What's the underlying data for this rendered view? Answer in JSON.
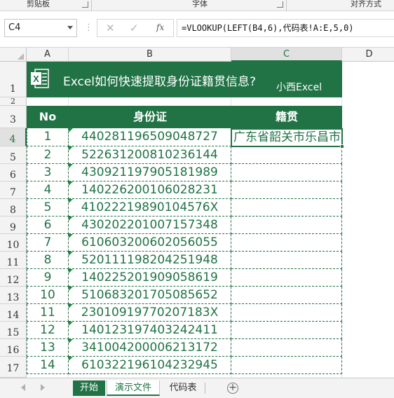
{
  "ribbon": {
    "groups": [
      "剪贴板",
      "字体",
      "对齐方式"
    ]
  },
  "formula_bar": {
    "cell_ref": "C4",
    "cancel_glyph": "✕",
    "enter_glyph": "✓",
    "fx_label": "fx",
    "formula": "=VLOOKUP(LEFT(B4,6),代码表!A:E,5,0)"
  },
  "columns": [
    "A",
    "B",
    "C",
    "D"
  ],
  "rows": [
    "1",
    "2",
    "3",
    "4",
    "5",
    "6",
    "7",
    "8",
    "9",
    "10",
    "11",
    "12",
    "13",
    "14",
    "15",
    "16",
    "17"
  ],
  "banner": {
    "icon_letter": "X",
    "title": "Excel如何快速提取身份证籍贯信息?",
    "brand": "小西Excel"
  },
  "table": {
    "headers": [
      "No",
      "身份证",
      "籍贯"
    ],
    "rows": [
      {
        "no": "1",
        "id": "440281196509048727",
        "origin": "广东省韶关市乐昌市"
      },
      {
        "no": "2",
        "id": "522631200810236144",
        "origin": ""
      },
      {
        "no": "3",
        "id": "430921197905181989",
        "origin": ""
      },
      {
        "no": "4",
        "id": "140226200106028231",
        "origin": ""
      },
      {
        "no": "5",
        "id": "41022219890104576X",
        "origin": ""
      },
      {
        "no": "6",
        "id": "430202201007157348",
        "origin": ""
      },
      {
        "no": "7",
        "id": "610603200602056055",
        "origin": ""
      },
      {
        "no": "8",
        "id": "520111198204251948",
        "origin": ""
      },
      {
        "no": "9",
        "id": "140225201909058619",
        "origin": ""
      },
      {
        "no": "10",
        "id": "510683201705085652",
        "origin": ""
      },
      {
        "no": "11",
        "id": "23010919770207183X",
        "origin": ""
      },
      {
        "no": "12",
        "id": "140123197403242411",
        "origin": ""
      },
      {
        "no": "13",
        "id": "341004200006213172",
        "origin": ""
      },
      {
        "no": "14",
        "id": "610322196104232945",
        "origin": ""
      }
    ]
  },
  "sheet_tabs": [
    "开始",
    "演示文件",
    "代码表"
  ],
  "add_sheet_glyph": "+",
  "colors": {
    "accent": "#217346",
    "header_text": "#ffffff",
    "cell_text": "#217346",
    "error_tick": "#1e8a3c"
  }
}
